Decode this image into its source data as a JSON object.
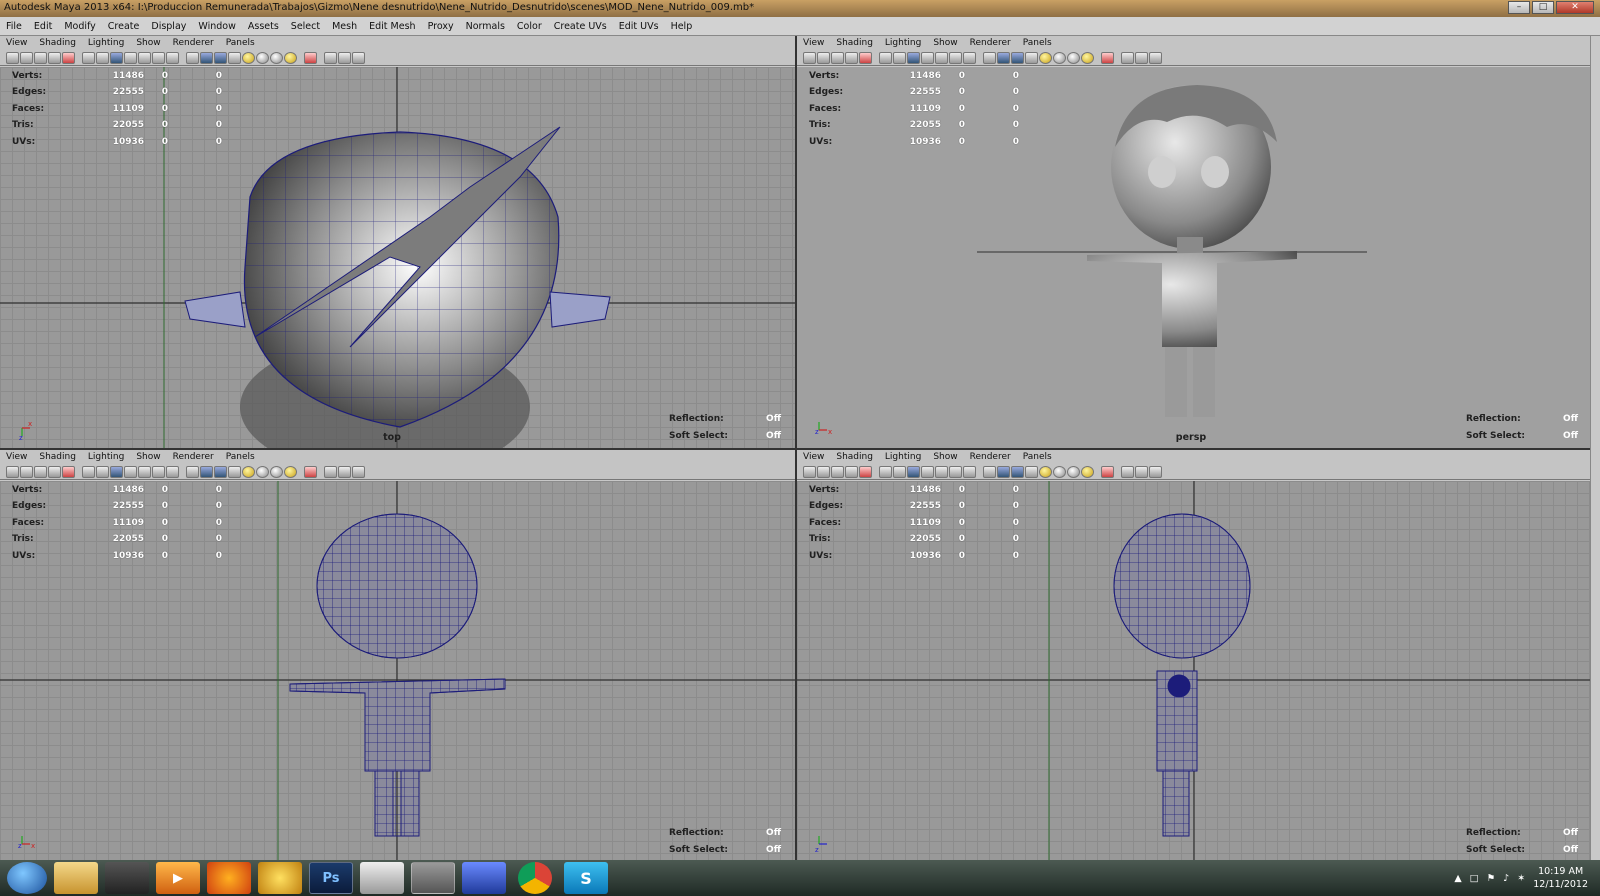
{
  "window": {
    "title": "Autodesk Maya 2013 x64: I:\\Produccion Remunerada\\Trabajos\\Gizmo\\Nene desnutrido\\Nene_Nutrido_Desnutrido\\scenes\\MOD_Nene_Nutrido_009.mb*"
  },
  "menu": [
    "File",
    "Edit",
    "Modify",
    "Create",
    "Display",
    "Window",
    "Assets",
    "Select",
    "Mesh",
    "Edit Mesh",
    "Proxy",
    "Normals",
    "Color",
    "Create UVs",
    "Edit UVs",
    "Help"
  ],
  "panel_menu": [
    "View",
    "Shading",
    "Lighting",
    "Show",
    "Renderer",
    "Panels"
  ],
  "hud": {
    "labels": {
      "verts": "Verts:",
      "edges": "Edges:",
      "faces": "Faces:",
      "tris": "Tris:",
      "uvs": "UVs:"
    },
    "values": {
      "verts": [
        "11486",
        "0",
        "0"
      ],
      "edges": [
        "22555",
        "0",
        "0"
      ],
      "faces": [
        "11109",
        "0",
        "0"
      ],
      "tris": [
        "22055",
        "0",
        "0"
      ],
      "uvs": [
        "10936",
        "0",
        "0"
      ]
    },
    "reflection_label": "Reflection:",
    "reflection_value": "Off",
    "soft_select_label": "Soft Select:",
    "soft_select_value": "Off"
  },
  "viewports": {
    "top": {
      "camera": "top"
    },
    "persp": {
      "camera": "persp"
    },
    "front": {
      "camera": ""
    },
    "side": {
      "camera": ""
    }
  },
  "axes": {
    "x": "x",
    "y": "y",
    "z": "z"
  },
  "taskbar": {
    "apps": [
      "start-orb",
      "explorer",
      "app-3",
      "media-player",
      "firefox",
      "app-6",
      "photoshop",
      "app-8",
      "maya",
      "app-10",
      "chrome",
      "skype"
    ],
    "ps_label": "Ps",
    "skype_label": "S",
    "time": "10:19 AM",
    "date": "12/11/2012"
  },
  "colors": {
    "wire": "#1c1c7a",
    "grid": "#8c8c8c",
    "viewport_bg": "#999999",
    "title_bg": "#b48a52"
  }
}
